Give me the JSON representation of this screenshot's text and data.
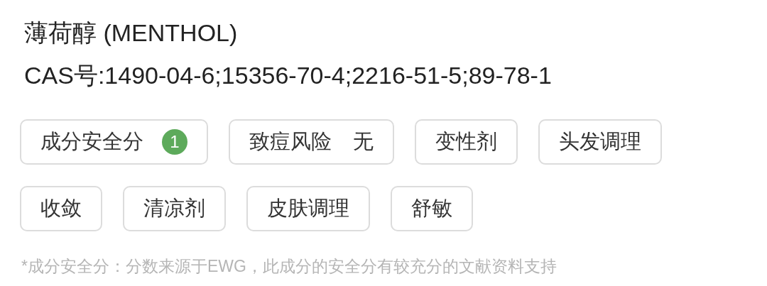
{
  "title": "薄荷醇 (MENTHOL)",
  "cas": "CAS号:1490-04-6;15356-70-4;2216-51-5;89-78-1",
  "tags": [
    {
      "kind": "score",
      "label": "成分安全分",
      "badge": "1",
      "color": "#5daa5b"
    },
    {
      "kind": "risk",
      "label": "致痘风险",
      "value": "无"
    },
    {
      "kind": "plain",
      "label": "变性剂"
    },
    {
      "kind": "plain",
      "label": "头发调理"
    },
    {
      "kind": "plain",
      "label": "收敛"
    },
    {
      "kind": "plain",
      "label": "清凉剂"
    },
    {
      "kind": "plain",
      "label": "皮肤调理"
    },
    {
      "kind": "plain",
      "label": "舒敏"
    }
  ],
  "footnote": "*成分安全分：分数来源于EWG，此成分的安全分有较充分的文献资料支持"
}
